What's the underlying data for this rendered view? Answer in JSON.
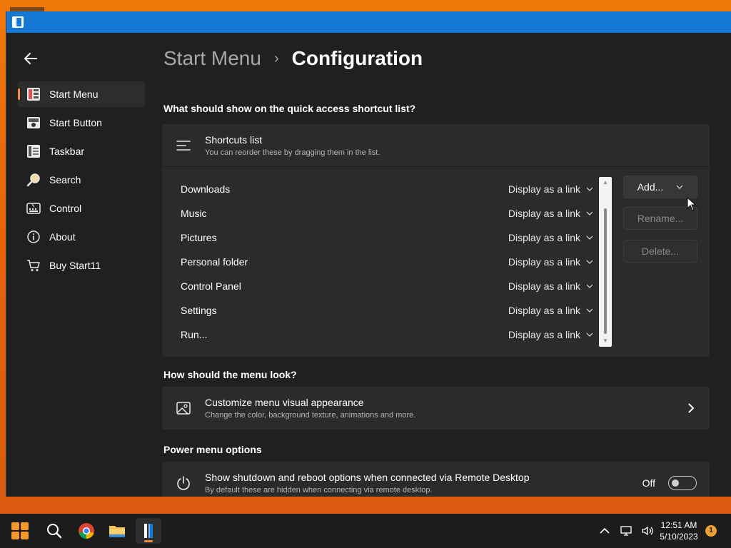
{
  "window": {
    "title": ""
  },
  "sidebar": {
    "back_icon": "arrow-left-icon",
    "items": [
      {
        "label": "Start Menu",
        "icon": "start-menu-icon",
        "active": true
      },
      {
        "label": "Start Button",
        "icon": "start-button-icon",
        "active": false
      },
      {
        "label": "Taskbar",
        "icon": "taskbar-icon",
        "active": false
      },
      {
        "label": "Search",
        "icon": "search-icon",
        "active": false
      },
      {
        "label": "Control",
        "icon": "control-icon",
        "active": false
      },
      {
        "label": "About",
        "icon": "info-icon",
        "active": false
      },
      {
        "label": "Buy Start11",
        "icon": "cart-icon",
        "active": false
      }
    ]
  },
  "breadcrumb": {
    "parent": "Start Menu",
    "separator": "›",
    "current": "Configuration"
  },
  "quick_access": {
    "question": "What should show on the quick access shortcut list?",
    "card_title": "Shortcuts list",
    "card_subtitle": "You can reorder these by dragging them in the list.",
    "rows": [
      {
        "name": "Downloads",
        "mode": "Display as a link"
      },
      {
        "name": "Music",
        "mode": "Display as a link"
      },
      {
        "name": "Pictures",
        "mode": "Display as a link"
      },
      {
        "name": "Personal folder",
        "mode": "Display as a link"
      },
      {
        "name": "Control Panel",
        "mode": "Display as a link"
      },
      {
        "name": "Settings",
        "mode": "Display as a link"
      },
      {
        "name": "Run...",
        "mode": "Display as a link"
      }
    ],
    "buttons": {
      "add": "Add...",
      "rename": "Rename...",
      "delete": "Delete..."
    }
  },
  "menu_look": {
    "question": "How should the menu look?",
    "title": "Customize menu visual appearance",
    "subtitle": "Change the color, background texture, animations and more."
  },
  "power": {
    "question": "Power menu options",
    "title": "Show shutdown and reboot options when connected via Remote Desktop",
    "subtitle": "By default these are hidden when connecting via remote desktop.",
    "toggle_label": "Off",
    "toggle_on": false
  },
  "taskbar": {
    "apps": [
      "windows-start-icon",
      "search-icon",
      "chrome-icon",
      "file-explorer-icon",
      "start11-icon"
    ],
    "time": "12:51 AM",
    "date": "5/10/2023",
    "notification_count": "1"
  },
  "colors": {
    "accent": "#f08a4b",
    "titlebar": "#1478d4",
    "background": "#202020",
    "card": "#2b2b2b"
  }
}
